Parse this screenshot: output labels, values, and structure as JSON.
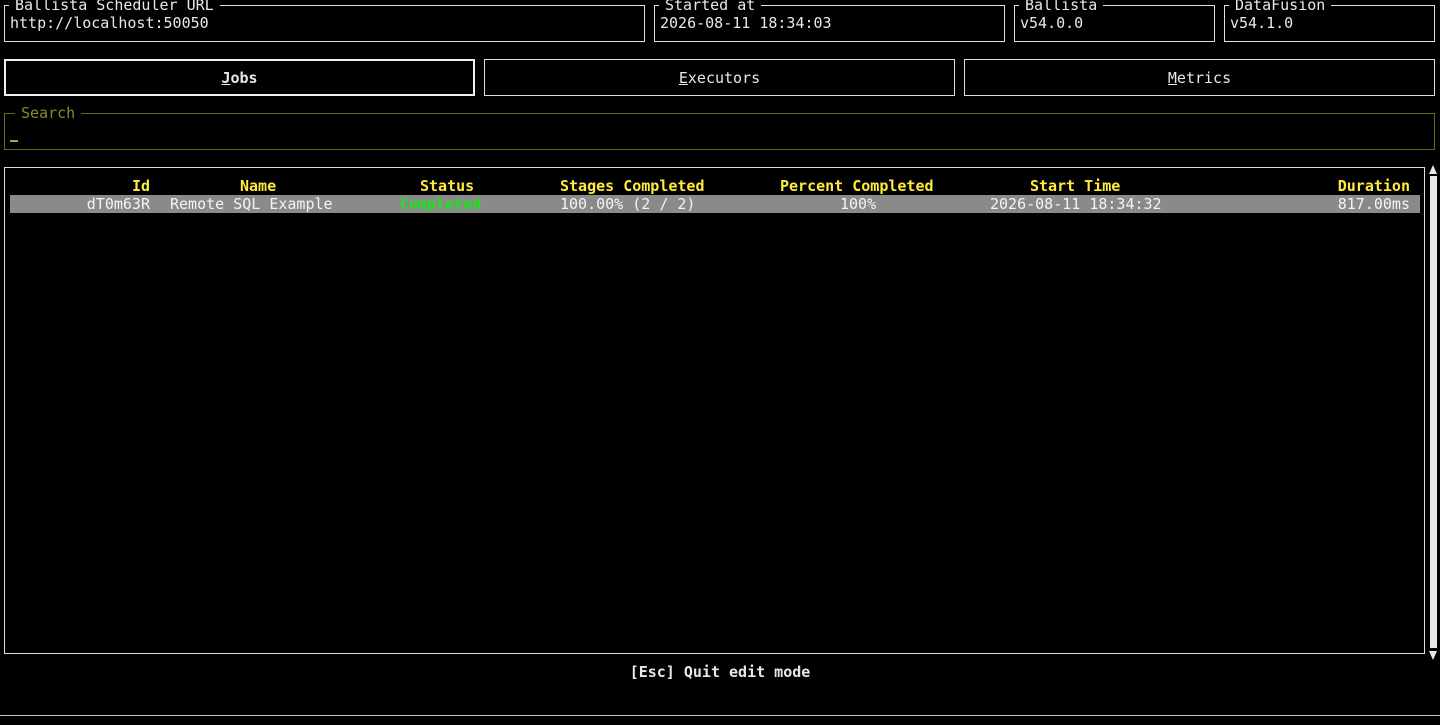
{
  "header": {
    "scheduler": {
      "title": "Ballista Scheduler URL",
      "value": "http://localhost:50050"
    },
    "started": {
      "title": "Started at",
      "value": "2026-08-11 18:34:03"
    },
    "ballista": {
      "title": "Ballista",
      "value": "v54.0.0"
    },
    "datafusion": {
      "title": "DataFusion",
      "value": "v54.1.0"
    }
  },
  "tabs": [
    {
      "key": "J",
      "rest": "obs",
      "active": true
    },
    {
      "key": "E",
      "rest": "xecutors",
      "active": false
    },
    {
      "key": "M",
      "rest": "etrics",
      "active": false
    }
  ],
  "search": {
    "title": "Search",
    "value": ""
  },
  "table": {
    "columns": [
      "Id",
      "Name",
      "Status",
      "Stages Completed",
      "Percent Completed",
      "Start Time",
      "Duration"
    ],
    "rows": [
      {
        "id": "dT0m63R",
        "name": "Remote SQL Example",
        "status": "Completed",
        "stages": "100.00% (2 / 2)",
        "percent": "100%",
        "start": "2026-08-11 18:34:32",
        "duration": "817.00ms"
      }
    ]
  },
  "footer": {
    "hint": "[Esc] Quit edit mode"
  },
  "colors": {
    "header_text": "#ffeb3b",
    "status_completed": "#19e619",
    "selected_row": "#8a8a8a",
    "search_border": "#6b6b17"
  }
}
